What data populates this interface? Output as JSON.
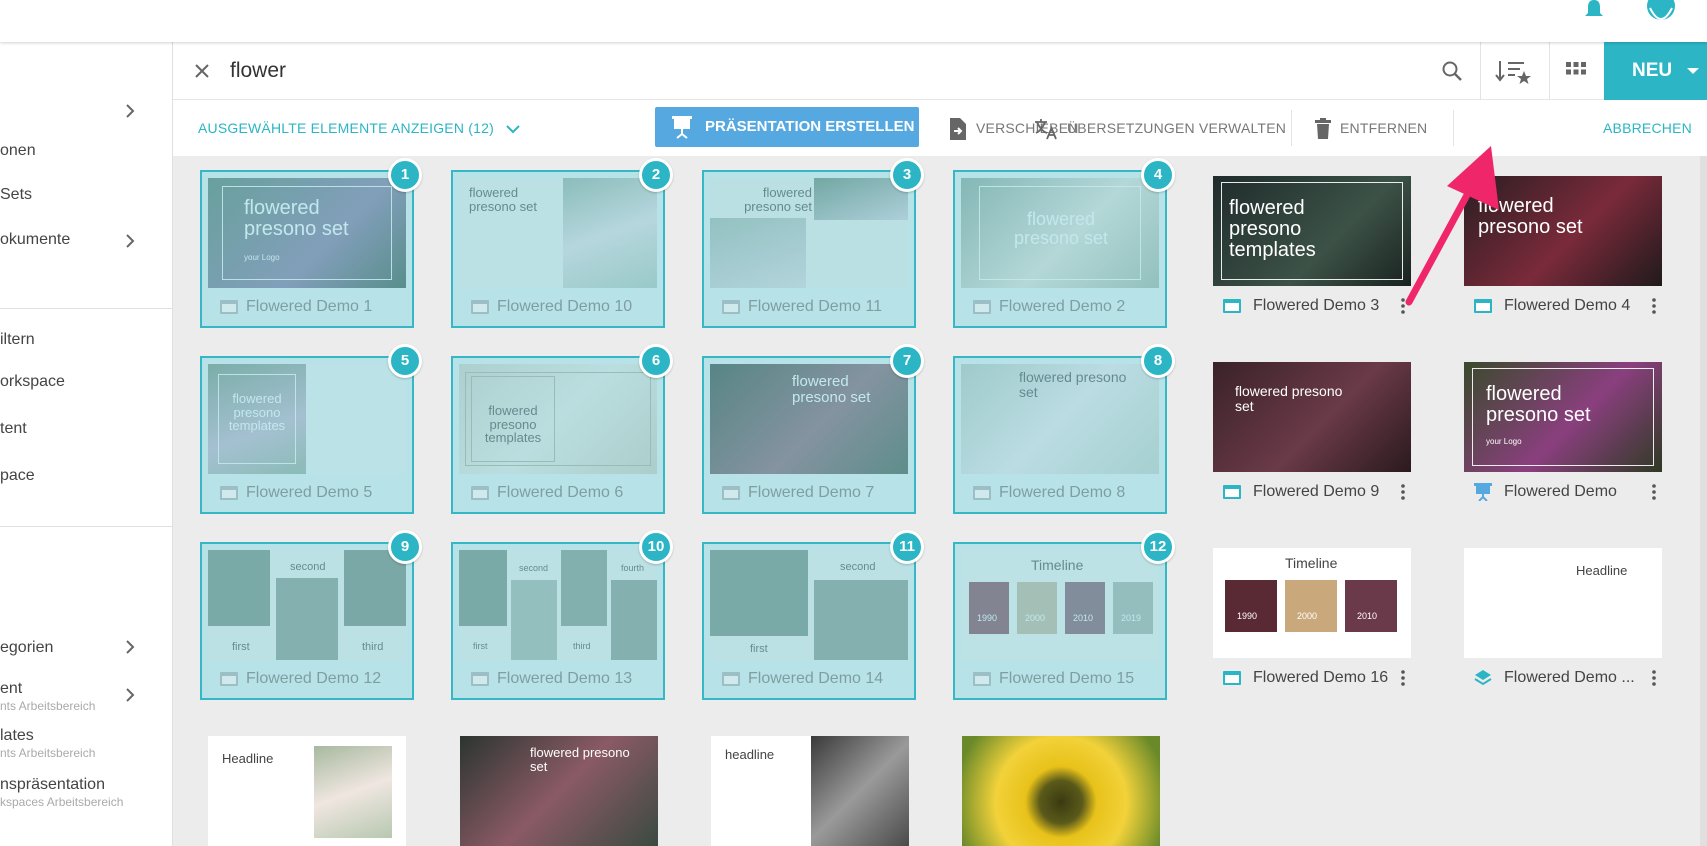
{
  "topbar": {
    "bell_icon": "bell-icon",
    "avatar_icon": "user-avatar"
  },
  "sidebar": {
    "items": [
      {
        "label": "onen",
        "sub": ""
      },
      {
        "label": "Sets",
        "sub": ""
      },
      {
        "label": "okumente",
        "sub": ""
      },
      {
        "label": "iltern",
        "sub": ""
      },
      {
        "label": "orkspace",
        "sub": ""
      },
      {
        "label": "tent",
        "sub": ""
      },
      {
        "label": "pace",
        "sub": ""
      },
      {
        "label": "egorien",
        "sub": ""
      },
      {
        "label": "ent",
        "sub": "nts Arbeitsbereich"
      },
      {
        "label": "lates",
        "sub": "nts Arbeitsbereich"
      },
      {
        "label": "nspräsentation",
        "sub": "kspaces Arbeitsbereich"
      }
    ]
  },
  "search": {
    "value": "flower",
    "placeholder": ""
  },
  "toolbar": {
    "new_label": "NEU"
  },
  "actions": {
    "show_selected": "AUSGEWÄHLTE ELEMENTE ANZEIGEN (12)",
    "create_presentation": "PRÄSENTATION ERSTELLEN",
    "move": "VERSCHIEBEN",
    "translations": "ÜBERSETZUNGEN VERWALTEN",
    "remove": "ENTFERNEN",
    "cancel": "ABBRECHEN"
  },
  "thumb_text": {
    "flowered_presono_set": "flowered presono set",
    "flowered_presono_templates": "flowered presono templates",
    "your_logo": "your Logo",
    "timeline": "Timeline",
    "headline": "Headline",
    "headline_lower": "headline",
    "first": "first",
    "second": "second",
    "third": "third",
    "fourth": "fourth",
    "years": [
      "1990",
      "2000",
      "2010",
      "2019"
    ]
  },
  "cards": [
    {
      "name": "Flowered Demo 1",
      "badge": "1"
    },
    {
      "name": "Flowered Demo 10",
      "badge": "2"
    },
    {
      "name": "Flowered Demo 11",
      "badge": "3"
    },
    {
      "name": "Flowered Demo 2",
      "badge": "4"
    },
    {
      "name": "Flowered Demo 3",
      "badge": ""
    },
    {
      "name": "Flowered Demo 4",
      "badge": ""
    },
    {
      "name": "Flowered Demo 5",
      "badge": "5"
    },
    {
      "name": "Flowered Demo 6",
      "badge": "6"
    },
    {
      "name": "Flowered Demo 7",
      "badge": "7"
    },
    {
      "name": "Flowered Demo 8",
      "badge": "8"
    },
    {
      "name": "Flowered Demo 9",
      "badge": ""
    },
    {
      "name": "Flowered Demo",
      "badge": ""
    },
    {
      "name": "Flowered Demo 12",
      "badge": "9"
    },
    {
      "name": "Flowered Demo 13",
      "badge": "10"
    },
    {
      "name": "Flowered Demo 14",
      "badge": "11"
    },
    {
      "name": "Flowered Demo 15",
      "badge": "12"
    },
    {
      "name": "Flowered Demo 16",
      "badge": ""
    },
    {
      "name": "Flowered Demo ...",
      "badge": ""
    }
  ],
  "colors": {
    "accent": "#2bb5c5",
    "present_button": "#56a8e0",
    "arrow": "#f0266a"
  }
}
